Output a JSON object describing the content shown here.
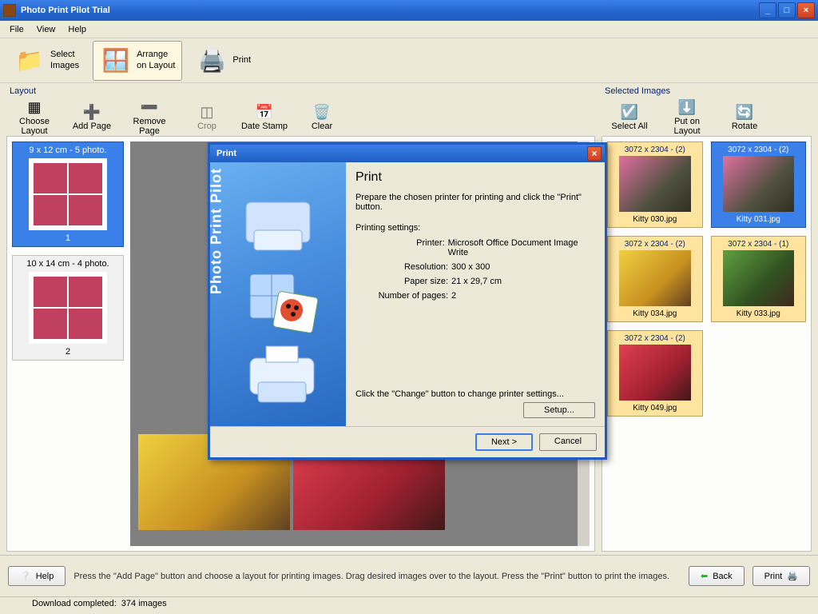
{
  "window": {
    "title": "Photo Print Pilot Trial"
  },
  "menu": {
    "file": "File",
    "view": "View",
    "help": "Help"
  },
  "toolbar": {
    "select_images": "Select\nImages",
    "arrange": "Arrange\non Layout",
    "print": "Print"
  },
  "layout": {
    "title": "Layout",
    "tools": {
      "choose": "Choose Layout",
      "add_page": "Add Page",
      "remove_page": "Remove Page",
      "crop": "Crop",
      "date_stamp": "Date Stamp",
      "clear": "Clear"
    },
    "thumbs": [
      {
        "caption_top": "9 x 12 cm - 5 photo.",
        "caption_bottom": "1"
      },
      {
        "caption_top": "10 x 14 cm - 4 photo.",
        "caption_bottom": "2"
      }
    ]
  },
  "selected": {
    "title": "Selected Images",
    "tools": {
      "select_all": "Select All",
      "put": "Put on Layout",
      "rotate": "Rotate"
    },
    "items": [
      {
        "dim": "3072 x 2304 - (2)",
        "name": "Kitty 030.jpg",
        "c": "img-pink"
      },
      {
        "dim": "3072 x 2304 - (2)",
        "name": "Kitty 031.jpg",
        "c": "img-pink",
        "sel": true
      },
      {
        "dim": "3072 x 2304 - (2)",
        "name": "Kitty 034.jpg",
        "c": "img-yellow"
      },
      {
        "dim": "3072 x 2304 - (1)",
        "name": "Kitty 033.jpg",
        "c": "img-vine"
      },
      {
        "dim": "3072 x 2304 - (2)",
        "name": "Kitty 049.jpg",
        "c": "img-red"
      }
    ]
  },
  "footer": {
    "help": "Help",
    "hint": "Press the \"Add Page\" button and choose a layout for printing images. Drag desired images over to the layout. Press the \"Print\" button to print the images.",
    "back": "Back",
    "print": "Print"
  },
  "status": {
    "label": "Download completed:",
    "value": "374 images"
  },
  "dialog": {
    "title": "Print",
    "side_label": "Photo Print Pilot",
    "heading": "Print",
    "intro": "Prepare the chosen printer for printing and click the \"Print\" button.",
    "settings_label": "Printing settings:",
    "printer_lbl": "Printer:",
    "printer_val": "Microsoft Office Document Image Write",
    "res_lbl": "Resolution:",
    "res_val": "300 x 300",
    "paper_lbl": "Paper size:",
    "paper_val": "21 x 29,7 cm",
    "pages_lbl": "Number of pages:",
    "pages_val": "2",
    "change_hint": "Click the \"Change\" button to change printer settings...",
    "setup": "Setup...",
    "next": "Next >",
    "cancel": "Cancel"
  }
}
